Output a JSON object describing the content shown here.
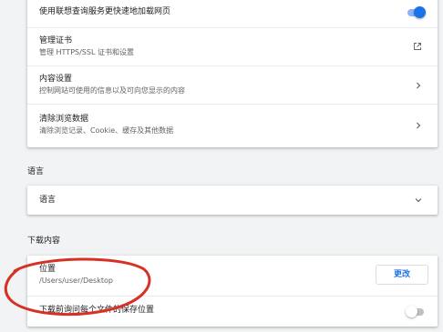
{
  "privacy": {
    "lenovo_lookup": {
      "title": "使用联想查询服务更快速地加载网页",
      "toggle_on": true
    },
    "certs": {
      "title": "管理证书",
      "subtitle": "管理 HTTPS/SSL 证书和设置",
      "icon": "external-link-icon"
    },
    "content": {
      "title": "内容设置",
      "subtitle": "控制网站可使用的信息以及可向您显示的内容",
      "icon": "chevron-right-icon"
    },
    "clear": {
      "title": "清除浏览数据",
      "subtitle": "清除浏览记录、Cookie、缓存及其他数据",
      "icon": "chevron-right-icon"
    }
  },
  "language": {
    "heading": "语言",
    "row_label": "语言",
    "icon": "chevron-down-icon"
  },
  "downloads": {
    "heading": "下载内容",
    "location": {
      "title": "位置",
      "path": "/Users/user/Desktop",
      "button_label": "更改"
    },
    "ask": {
      "title": "下载前询问每个文件的保存位置",
      "toggle_on": false
    }
  },
  "colors": {
    "accent": "#1a73e8",
    "annotation": "#d93025"
  }
}
